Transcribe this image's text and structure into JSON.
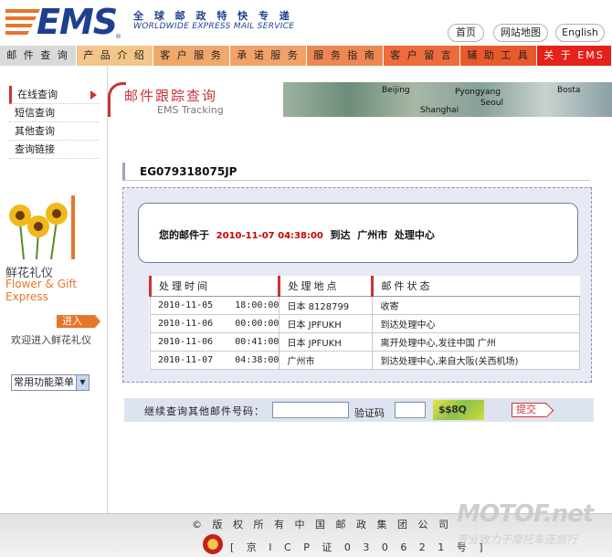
{
  "header": {
    "logo_text": "EMS",
    "tagline_cn": "全 球 邮 政 特 快 专 递",
    "tagline_en": "WORLDWIDE EXPRESS MAIL SERVICE",
    "links": [
      "首页",
      "网站地图",
      "English"
    ]
  },
  "nav": {
    "items": [
      {
        "label": "邮 件 查 询",
        "color": "#d9d9d9"
      },
      {
        "label": "产 品 介 绍",
        "color": "#f2c68a"
      },
      {
        "label": "客 户 服 务",
        "color": "#f0a86a"
      },
      {
        "label": "承 诺 服 务",
        "color": "#f2a268"
      },
      {
        "label": "服 务 指 南",
        "color": "#ee8752"
      },
      {
        "label": "客 户 留 言",
        "color": "#ec6c3c"
      },
      {
        "label": "辅 助 工 具",
        "color": "#e85a2c"
      },
      {
        "label": "关 于 EMS",
        "color": "#e6201a"
      }
    ]
  },
  "sidebar": {
    "items": [
      "在线查询",
      "短信查询",
      "其他查询",
      "查询链接"
    ],
    "flower_cn": "鲜花礼仪",
    "flower_en": "Flower & Gift Express",
    "enter_label": "进入",
    "welcome": "欢迎进入鲜花礼仪",
    "function_menu": "常用功能菜单"
  },
  "banner": {
    "title_cn": "邮件跟踪查询",
    "title_en": "EMS Tracking",
    "map_labels": [
      "Beijing",
      "Pyongyang",
      "Seoul",
      "Shanghai",
      "Bosta"
    ]
  },
  "tracking": {
    "number": "EG079318075JP",
    "status_prefix": "您的邮件于",
    "status_time": "2010-11-07 04:38:00",
    "status_suffix": "到达  广州市  处理中心"
  },
  "table": {
    "headers": [
      "处理时间",
      "处理地点",
      "邮件状态"
    ],
    "rows": [
      {
        "time": "2010-11-05    18:00:00",
        "place": "日本 8128799",
        "status": "收寄"
      },
      {
        "time": "2010-11-06    00:00:00",
        "place": "日本 JPFUKH",
        "status": "到达处理中心"
      },
      {
        "time": "2010-11-06    00:41:00",
        "place": "日本 JPFUKH",
        "status": "离开处理中心,发往中国 广州"
      },
      {
        "time": "2010-11-07    04:38:00",
        "place": "广州市",
        "status": "到达处理中心,来自大阪(关西机场)"
      }
    ]
  },
  "query": {
    "label": "继续查询其他邮件号码：",
    "captcha_label": "验证码",
    "captcha_text": "$$8Q",
    "submit": "提交"
  },
  "footer": {
    "copyright": "© 版 权 所 有 中 国 邮 政 集 团 公 司",
    "icp": "[ 京 I C P 证 0 3 0 6 2 1 号 ]",
    "watermark": "MOTOF.net",
    "watermark_sub": "专业致力于摩托车连旅行"
  }
}
